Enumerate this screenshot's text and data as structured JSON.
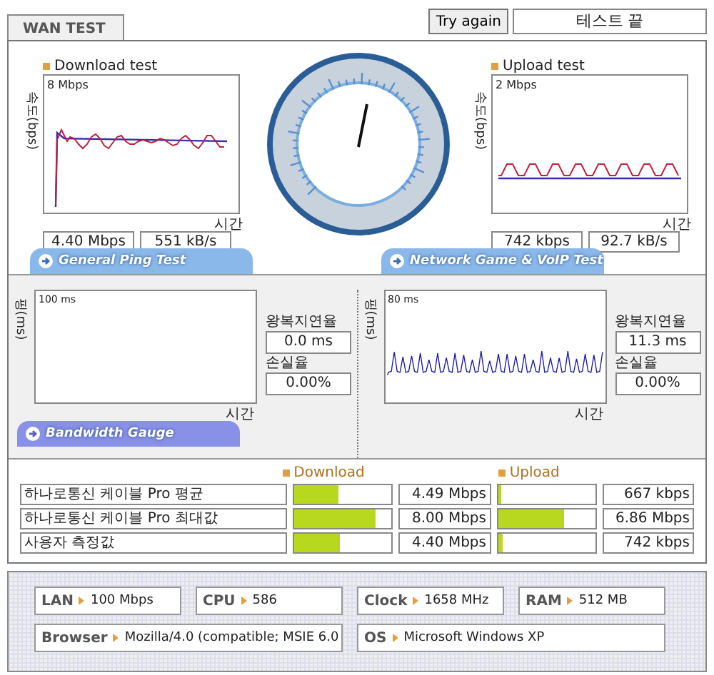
{
  "tab": {
    "label": "WAN TEST",
    "selected": true
  },
  "try_again": "Try again",
  "status": "테스트 끝",
  "speed": [
    {
      "title": "Download test",
      "axis": "속도(bps)",
      "scale": "8 Mbps",
      "time_label": "시간",
      "rate": "4.40 Mbps",
      "bytes": "551 kB/s",
      "kind": "download"
    },
    {
      "title": "Upload test",
      "axis": "속도(bps)",
      "scale": "2 Mbps",
      "time_label": "시간",
      "rate": "742 kbps",
      "bytes": "92.7 kB/s",
      "kind": "upload"
    }
  ],
  "section_tabs": [
    "General Ping Test",
    "Network Game & VoIP Test"
  ],
  "ping": [
    {
      "axis": "핑(ms)",
      "scale": "100 ms",
      "time_label": "시간",
      "rtt_label": "왕복지연율",
      "rtt": "0.0 ms",
      "loss_label": "손실율",
      "loss": "0.00%",
      "trace": false
    },
    {
      "axis": "핑(ms)",
      "scale": "80 ms",
      "time_label": "시간",
      "rtt_label": "왕복지연율",
      "rtt": "11.3 ms",
      "loss_label": "손실율",
      "loss": "0.00%",
      "trace": true
    }
  ],
  "bandwidth": {
    "title": "Bandwidth Gauge",
    "columns": [
      "Download",
      "Upload"
    ],
    "rows": [
      {
        "name": "하나로통신 케이블 Pro 평균",
        "download": {
          "level": 0.45,
          "reading": "4.49 Mbps"
        },
        "upload": {
          "level": 0.04,
          "reading": "667 kbps"
        }
      },
      {
        "name": "하나로통신 케이블 Pro 최대값",
        "download": {
          "level": 0.83,
          "reading": "8.00 Mbps"
        },
        "upload": {
          "level": 0.68,
          "reading": "6.86 Mbps"
        }
      },
      {
        "name": "사용자 측정값",
        "download": {
          "level": 0.47,
          "reading": "4.40 Mbps"
        },
        "upload": {
          "level": 0.05,
          "reading": "742 kbps"
        }
      }
    ]
  },
  "system": [
    {
      "label": "LAN",
      "value": "100 Mbps"
    },
    {
      "label": "CPU",
      "value": "586"
    },
    {
      "label": "Clock",
      "value": "1658 MHz"
    },
    {
      "label": "RAM",
      "value": "512 MB"
    },
    {
      "label": "Browser",
      "value": "Mozilla/4.0 (compatible; MSIE 6.0"
    },
    {
      "label": "OS",
      "value": "Microsoft Windows XP"
    }
  ]
}
